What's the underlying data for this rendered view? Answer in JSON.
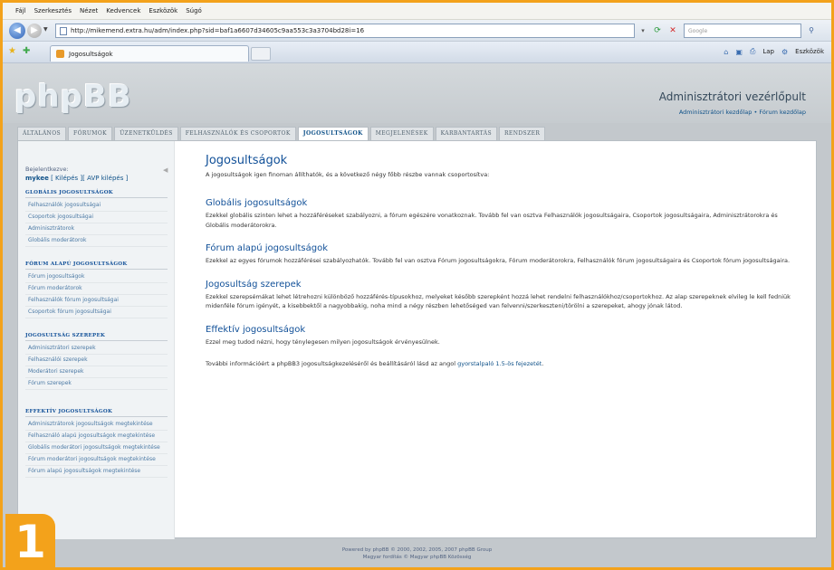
{
  "browser": {
    "menu": [
      "Fájl",
      "Szerkesztés",
      "Nézet",
      "Kedvencek",
      "Eszközök",
      "Súgó"
    ],
    "url": "http://mikemend.extra.hu/adm/index.php?sid=baf1a6607d34605c9aa553c3a3704bd28i=16",
    "search_placeholder": "Google",
    "tab_title": "Jogosultságok",
    "cmd": {
      "page": "Lap",
      "tools": "Eszközök"
    }
  },
  "acp": {
    "logo": "phpBB",
    "title": "Adminisztrátori vezérlőpult",
    "links": {
      "admin_home": "Adminisztrátori kezdőlap",
      "sep": " • ",
      "forum_home": "Fórum kezdőlap"
    },
    "tabs": [
      {
        "label": "ÁLTALÁNOS",
        "active": false
      },
      {
        "label": "FÓRUMOK",
        "active": false
      },
      {
        "label": "ÜZENETKÜLDÉS",
        "active": false
      },
      {
        "label": "FELHASZNÁLÓK ÉS CSOPORTOK",
        "active": false
      },
      {
        "label": "JOGOSULTSÁGOK",
        "active": true
      },
      {
        "label": "MEGJELENÉSEK",
        "active": false
      },
      {
        "label": "KARBANTARTÁS",
        "active": false
      },
      {
        "label": "RENDSZER",
        "active": false
      }
    ]
  },
  "sidebar": {
    "login_label": "Bejelentkezve:",
    "user": "mykee",
    "logout": "[ Kilépés ]",
    "avp_logout": "[ AVP kilépés ]",
    "sections": [
      {
        "heading": "GLOBÁLIS JOGOSULTSÁGOK",
        "items": [
          "Felhasználók jogosultságai",
          "Csoportok jogosultságai",
          "Adminisztrátorok",
          "Globális moderátorok"
        ]
      },
      {
        "heading": "FÓRUM ALAPÚ JOGOSULTSÁGOK",
        "items": [
          "Fórum jogosultságok",
          "Fórum moderátorok",
          "Felhasználók fórum jogosultságai",
          "Csoportok fórum jogosultságai"
        ]
      },
      {
        "heading": "JOGOSULTSÁG SZEREPEK",
        "items": [
          "Adminisztrátori szerepek",
          "Felhasználói szerepek",
          "Moderátori szerepek",
          "Fórum szerepek"
        ]
      },
      {
        "heading": "EFFEKTÍV JOGOSULTSÁGOK",
        "items": [
          "Adminisztrátorok jogosultságok megtekintése",
          "Felhasználó alapú jogosultságok megtekintése",
          "Globális moderátori jogosultságok megtekintése",
          "Fórum moderátori jogosultságok megtekintése",
          "Fórum alapú jogosultságok megtekintése"
        ]
      }
    ]
  },
  "content": {
    "title": "Jogosultságok",
    "intro": "A jogosultságok igen finoman állíthatók, és a következő négy főbb részbe vannak csoportosítva:",
    "sections": [
      {
        "title": "Globális jogosultságok",
        "text": "Ezekkel globális szinten lehet a hozzáféréseket szabályozni, a fórum egészére vonatkoznak. Tovább fel van osztva Felhasználók jogosultságaira, Csoportok jogosultságaira, Adminisztrátorokra és Globális moderátorokra."
      },
      {
        "title": "Fórum alapú jogosultságok",
        "text": "Ezekkel az egyes fórumok hozzáférései szabályozhatók. Tovább fel van osztva Fórum jogosultságokra, Fórum moderátorokra, Felhasználók fórum jogosultságaira és Csoportok fórum jogosultságaira."
      },
      {
        "title": "Jogosultság szerepek",
        "text": "Ezekkel szerepsémákat lehet létrehozni különböző hozzáférés-típusokhoz, melyeket később szerepként hozzá lehet rendelni felhasználókhoz/csoportokhoz. Az alap szerepeknek elvileg le kell fedniük midenféle fórum igényét, a kisebbektől a nagyobbakig, noha mind a négy részben lehetőséged van felvenni/szerkeszteni/törölni a szerepeket, ahogy jónak látod."
      },
      {
        "title": "Effektív jogosultságok",
        "text": "Ezzel meg tudod nézni, hogy ténylegesen milyen jogosultságok érvényesülnek."
      }
    ],
    "more_info": "További információért a phpBB3 jogosultságkezeléséről és beállításáról lásd az angol ",
    "more_link": "gyorstalpaló 1.5-ös fejezetét",
    "more_end": "."
  },
  "footer": {
    "line1": "Powered by phpBB © 2000, 2002, 2005, 2007 phpBB Group",
    "line2": "Magyar fordítás © Magyar phpBB Közösség"
  },
  "badge": "1",
  "colors": {
    "frame": "#f3a21b",
    "link": "#105289",
    "heading": "#115098"
  }
}
